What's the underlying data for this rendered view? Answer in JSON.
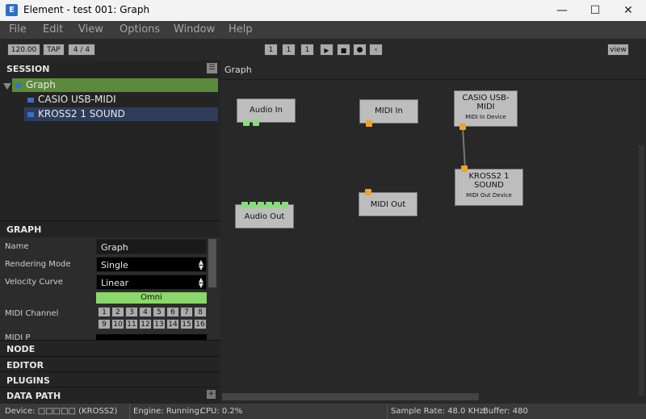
{
  "window": {
    "title": "Element - test 001: Graph",
    "app_icon": "E"
  },
  "menu": [
    "File",
    "Edit",
    "View",
    "Options",
    "Window",
    "Help"
  ],
  "toolbar": {
    "tempo": "120.00",
    "tap": "TAP",
    "meter": "4 / 4",
    "bar": "1",
    "beat": "1",
    "tick": "1",
    "view": "view"
  },
  "session": {
    "header": "SESSION",
    "graph_item": "Graph",
    "devices": [
      "CASIO USB-MIDI",
      "KROSS2 1 SOUND"
    ]
  },
  "graph_panel": {
    "header": "GRAPH",
    "props": {
      "name_label": "Name",
      "name_value": "Graph",
      "render_label": "Rendering Mode",
      "render_value": "Single",
      "velocity_label": "Velocity Curve",
      "velocity_value": "Linear",
      "channel_label": "MIDI Channel",
      "channel_omni": "Omni"
    },
    "channels": [
      "1",
      "2",
      "3",
      "4",
      "5",
      "6",
      "7",
      "8",
      "9",
      "10",
      "11",
      "12",
      "13",
      "14",
      "15",
      "16"
    ]
  },
  "sections": [
    "NODE",
    "EDITOR",
    "PLUGINS",
    "DATA PATH"
  ],
  "canvas": {
    "title": "Graph"
  },
  "nodes": {
    "audio_in": "Audio In",
    "midi_in": "MIDI In",
    "casio": "CASIO USB-MIDI",
    "casio_sub": "MIDI In Device",
    "kross": "KROSS2 1 SOUND",
    "kross_sub": "MIDI Out Device",
    "audio_out": "Audio Out",
    "midi_out": "MIDI Out"
  },
  "status": {
    "device": "Device: □□□□□ (KROSS2)",
    "engine": "Engine: Running:",
    "cpu": "CPU: 0.2%",
    "sample_rate": "Sample Rate: 48.0 KHz:",
    "buffer": "Buffer: 480"
  },
  "colors": {
    "audio_port": "#86e07a",
    "midi_port": "#f0a22a",
    "selected_row": "#5a8a3a",
    "device_row": "#2e3c5a"
  }
}
